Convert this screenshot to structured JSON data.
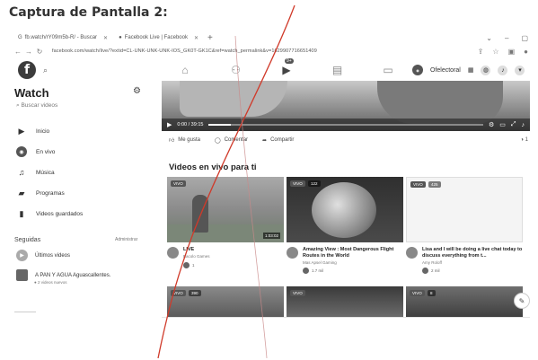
{
  "doc": {
    "heading": "Captura de Pantalla 2:"
  },
  "browser": {
    "tabs": [
      {
        "label": "fb.watch/rY09m5b-R/ - Buscar"
      },
      {
        "label": "Facebook Live | Facebook"
      }
    ],
    "new_tab": "+",
    "url": "facebook.com/watch/live/?extid=CL-UNK-UNK-UNK-IOS_GK0T-GK1C&ref=watch_permalink&v=1629907716651409"
  },
  "fb": {
    "logo": "f",
    "profile_name": "Ofelectoral",
    "nav_badge": "9+"
  },
  "sidebar": {
    "title": "Watch",
    "search_placeholder": "Buscar videos",
    "items": [
      {
        "label": "Inicio",
        "icon": "tv-icon"
      },
      {
        "label": "En vivo",
        "icon": "live-icon"
      },
      {
        "label": "Música",
        "icon": "music-note-icon"
      },
      {
        "label": "Programas",
        "icon": "clapper-icon"
      },
      {
        "label": "Videos guardados",
        "icon": "bookmark-icon"
      }
    ],
    "following_heading": "Seguidas",
    "manage_label": "Administrar",
    "subscriptions": [
      {
        "label": "Últimos videos"
      },
      {
        "label": "A PAN Y AGUA Aguascallentes.",
        "sub": "2 videos nuevos"
      }
    ]
  },
  "player": {
    "time": "0:00 / 39:15",
    "progress_percent": 8
  },
  "actions": {
    "like": "Me gusta",
    "comment": "Comentar",
    "share": "Compartir",
    "count": "1"
  },
  "section": {
    "title": "Videos en vivo para ti"
  },
  "cards": [
    {
      "badge": "VIVO",
      "viewers": "",
      "duration": "1:03:02",
      "title": "LIVE",
      "channel": "Bacolo Games",
      "reactions": "1"
    },
    {
      "badge": "VIVO",
      "viewers": "122",
      "duration": "",
      "title": "Amazing View : Most Dangerous Flight Routes in the World",
      "channel": "Mas Apsel Gaming",
      "reactions": "1.7 mil"
    },
    {
      "badge": "VIVO",
      "viewers": "425",
      "duration": "",
      "title": "Lisa and I will be doing a live chat today to discuss everything from t...",
      "channel": "Amy Roloff",
      "reactions": "2 mil"
    }
  ],
  "row2": [
    {
      "badge": "VIVO",
      "viewers": "390"
    },
    {
      "badge": "VIVO",
      "viewers": ""
    },
    {
      "badge": "VIVO",
      "viewers": "8"
    }
  ]
}
